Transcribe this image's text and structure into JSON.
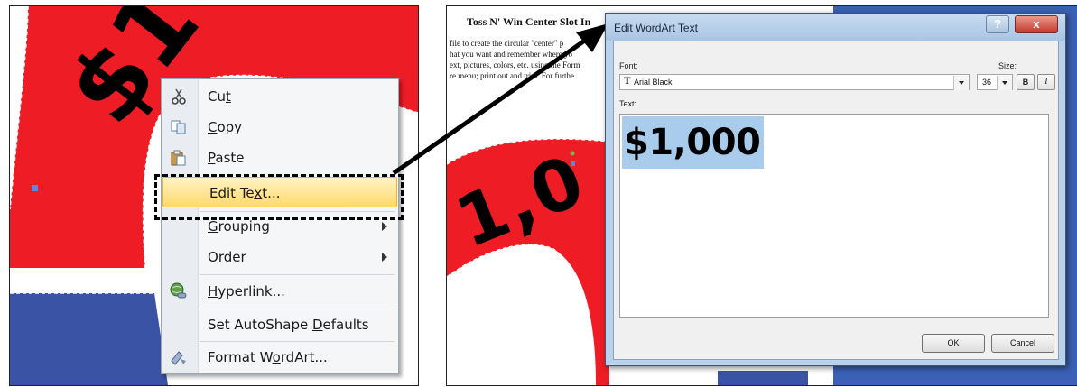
{
  "left_screenshot": {
    "wordart_fragment": "$1",
    "context_menu": {
      "items": [
        {
          "label": "Cut",
          "underline_index": 2,
          "icon": "scissors-icon"
        },
        {
          "label": "Copy",
          "underline_index": 0,
          "icon": "copy-icon"
        },
        {
          "label": "Paste",
          "underline_index": 0,
          "icon": "paste-icon"
        },
        {
          "label": "Edit Text...",
          "underline_index": 6,
          "icon": "",
          "highlighted": true
        },
        {
          "label": "Grouping",
          "underline_index": 0,
          "icon": "",
          "submenu": true
        },
        {
          "label": "Order",
          "underline_index": 1,
          "icon": "",
          "submenu": true
        },
        {
          "label": "Hyperlink...",
          "underline_index": 0,
          "icon": "hyperlink-icon"
        },
        {
          "label": "Set AutoShape Defaults",
          "underline_index": 14,
          "icon": ""
        },
        {
          "label": "Format WordArt...",
          "underline_index": 8,
          "icon": "format-wordart-icon"
        }
      ]
    }
  },
  "right_screenshot": {
    "document": {
      "title": "Toss N' Win Center Slot In",
      "lines": [
        "file to create the circular \"center\" p",
        "hat you want and remember where yo",
        "ext, pictures, colors, etc. using the Form",
        "re menu; print out and trim. For furthe"
      ]
    },
    "wordart_fragment": "1,0",
    "dialog": {
      "title": "Edit WordArt Text",
      "help_label": "?",
      "close_label": "x",
      "font_label": "Font:",
      "font_value": "Arial Black",
      "size_label": "Size:",
      "size_value": "36",
      "bold_label": "B",
      "italic_label": "I",
      "text_label": "Text:",
      "text_value": "$1,000",
      "ok_label": "OK",
      "cancel_label": "Cancel"
    }
  },
  "colors": {
    "wordart_red": "#ee1c25",
    "shape_blue": "#3a53a4",
    "dialog_frame": "#b9d1ea",
    "menu_highlight": "#ffd96b",
    "text_selection": "#a9cbec"
  }
}
